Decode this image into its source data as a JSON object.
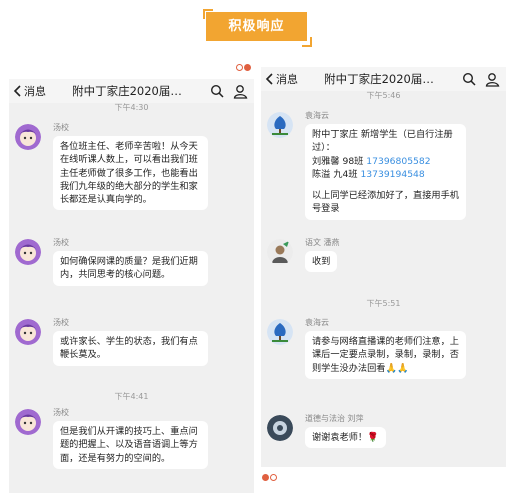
{
  "header": {
    "banner_text": "积极响应"
  },
  "left_panel": {
    "back_label": "消息",
    "title": "附中丁家庄2020届…",
    "cut_time": "下午4:30",
    "messages": [
      {
        "sender": "汤校",
        "text": "各位班主任、老师辛苦啦！从今天在线听课人数上，可以看出我们班主任老师做了很多工作，也能看出我们九年级的绝大部分的学生和家长都还是认真向学的。"
      },
      {
        "sender": "汤校",
        "text": "如何确保网课的质量？是我们近期内，共同思考的核心问题。"
      },
      {
        "sender": "汤校",
        "text": "或许家长、学生的状态，我们有点鞭长莫及。"
      },
      {
        "time": "下午4:41"
      },
      {
        "sender": "汤校",
        "text": "但是我们从开课的技巧上、重点问题的把握上、以及语音语调上等方面，还是有努力的空间的。"
      }
    ]
  },
  "right_panel": {
    "back_label": "消息",
    "title": "附中丁家庄2020届…",
    "cut_time": "下午5:46",
    "messages": [
      {
        "sender": "袁海云",
        "line1": "附中丁家庄  新增学生（已自行注册过）：",
        "row1_name": "刘雅馨 98班 ",
        "row1_phone": "17396805582",
        "row2_name": "陈溢  九4班 ",
        "row2_phone": "13739194548",
        "line_end": "以上同学已经添加好了，直接用手机号登录"
      },
      {
        "sender": "语文 潘燕",
        "text": "收到"
      },
      {
        "time": "下午5:51"
      },
      {
        "sender": "袁海云",
        "text": "请参与网络直播课的老师们注意，上课后一定要点录制，录制，录制，否则学生没办法回看",
        "emoji": "🙏🙏"
      },
      {
        "sender": "道德与法治  刘萍",
        "text": "谢谢袁老师！",
        "emoji": "🌹"
      }
    ]
  }
}
